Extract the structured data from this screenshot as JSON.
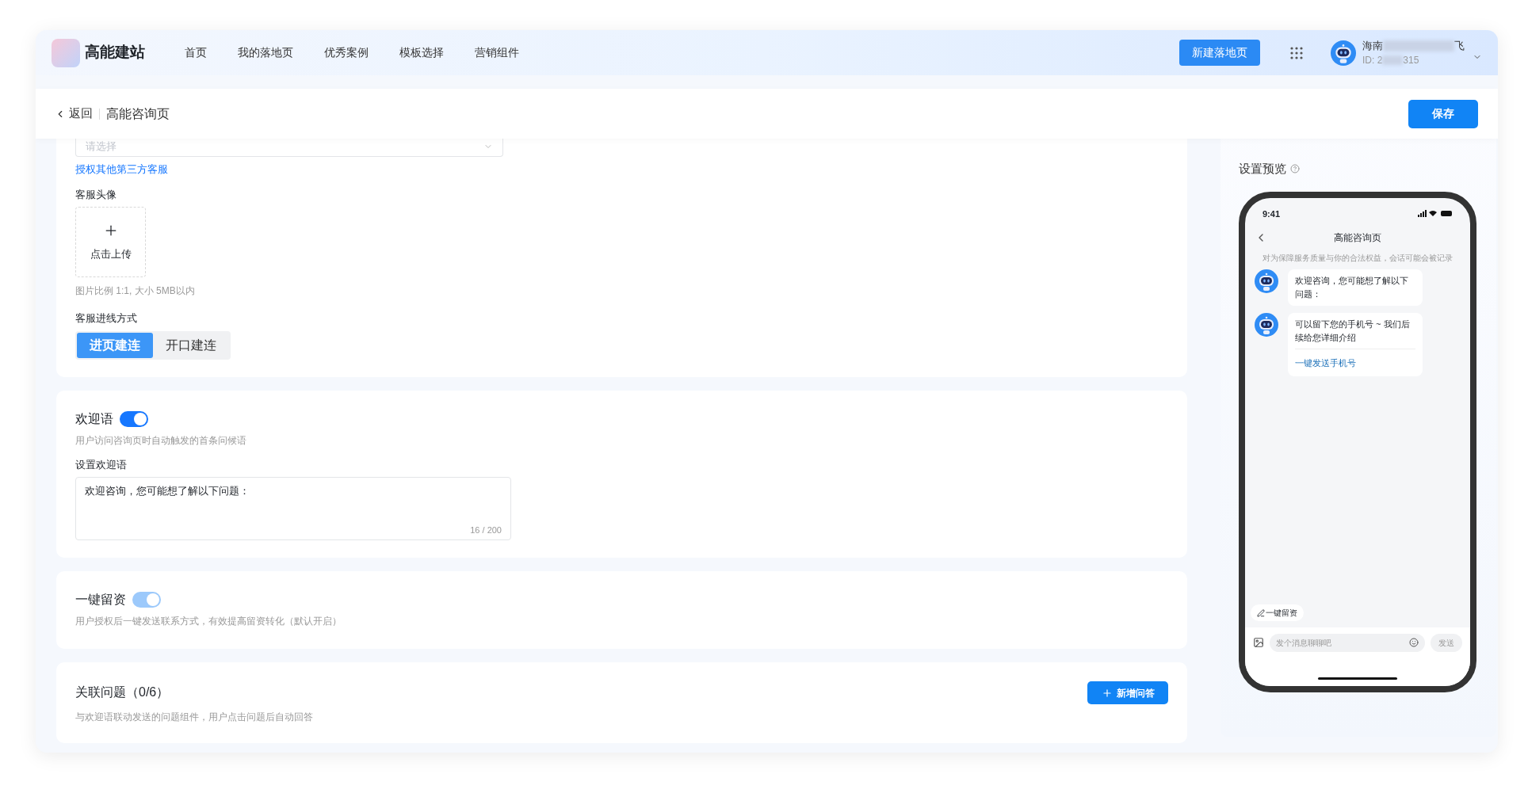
{
  "header": {
    "logo": "高能建站",
    "nav": [
      "首页",
      "我的落地页",
      "优秀案例",
      "模板选择",
      "营销组件"
    ],
    "create_button": "新建落地页",
    "user": {
      "name_start": "海南",
      "name_end": "飞",
      "id_start": "ID: 2",
      "id_end": "315"
    }
  },
  "page_bar": {
    "back": "返回",
    "title": "高能咨询页",
    "save": "保存"
  },
  "service": {
    "select_placeholder": "请选择",
    "authorize_link": "授权其他第三方客服",
    "avatar_label": "客服头像",
    "upload_text": "点击上传",
    "avatar_hint": "图片比例 1:1, 大小 5MB以内",
    "mode_label": "客服进线方式",
    "modes": [
      {
        "label": "进页建连",
        "selected": true
      },
      {
        "label": "开口建连",
        "selected": false
      }
    ]
  },
  "welcome": {
    "title": "欢迎语",
    "on": true,
    "disabled": false,
    "hint": "用户访问咨询页时自动触发的首条问候语",
    "field_label": "设置欢迎语",
    "value": "欢迎咨询，您可能想了解以下问题：",
    "counter": "16 / 200"
  },
  "lead": {
    "title": "一键留资",
    "on": true,
    "disabled": true,
    "hint": "用户授权后一键发送联系方式，有效提高留资转化（默认开启）"
  },
  "questions": {
    "title": "关联问题（0/6）",
    "hint": "与欢迎语联动发送的问题组件，用户点击问题后自动回答",
    "add_button": "新增问答"
  },
  "preview": {
    "title": "设置预览",
    "phone": {
      "time": "9:41",
      "title": "高能咨询页",
      "notice": "对为保障服务质量与你的合法权益，会话可能会被记录",
      "messages": [
        {
          "text": "欢迎咨询，您可能想了解以下问题："
        },
        {
          "text": "可以留下您的手机号 ~ 我们后续给您详细介绍",
          "action": "一键发送手机号"
        }
      ],
      "quick_action": "一键留资",
      "input_placeholder": "发个消息聊聊吧",
      "send": "发送"
    }
  }
}
